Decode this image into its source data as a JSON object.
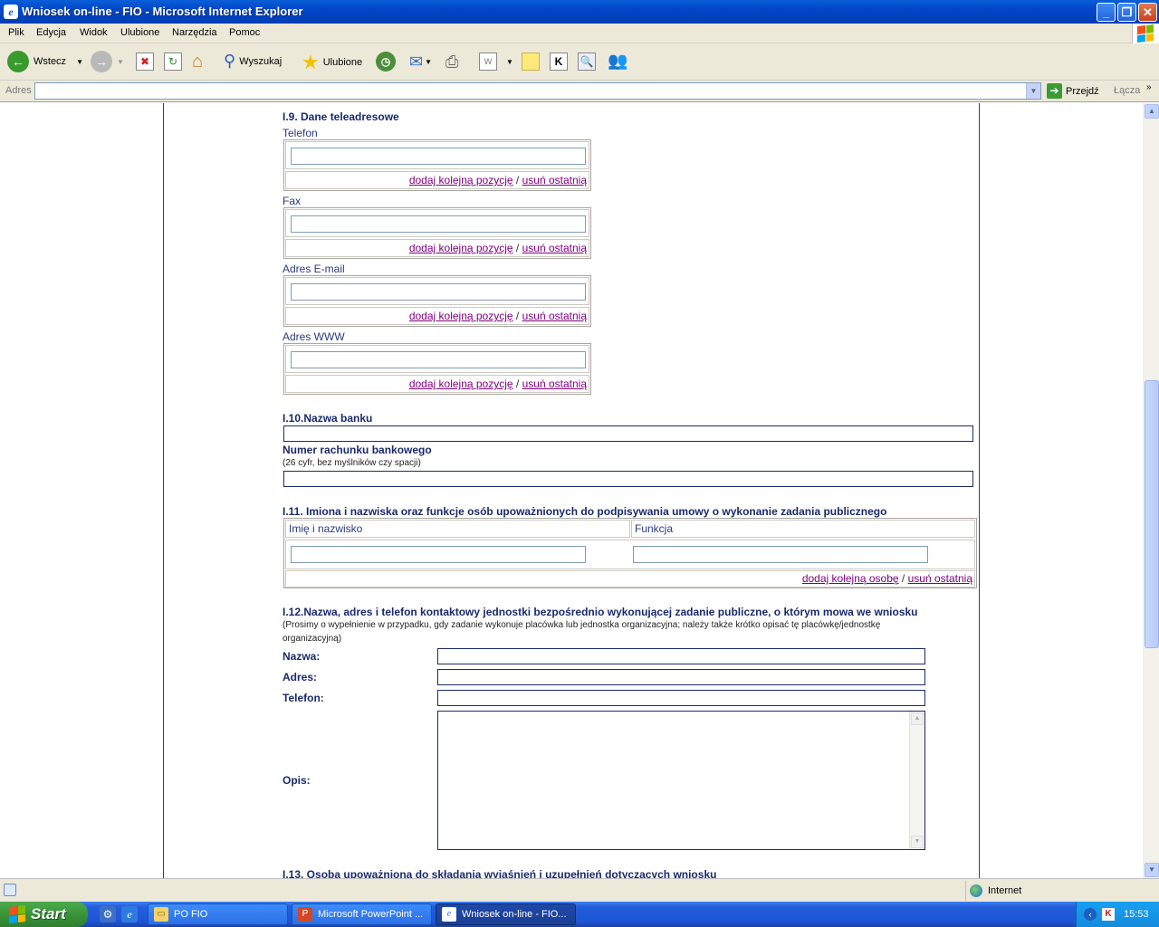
{
  "window": {
    "title": "Wniosek on-line - FIO - Microsoft Internet Explorer"
  },
  "menu": [
    "Plik",
    "Edycja",
    "Widok",
    "Ulubione",
    "Narzędzia",
    "Pomoc"
  ],
  "toolbar": {
    "back": "Wstecz",
    "search": "Wyszukaj",
    "favorites": "Ulubione"
  },
  "address": {
    "label": "Adres",
    "value": "",
    "go": "Przejdź",
    "links": "Łącza"
  },
  "form": {
    "s9_title": "I.9. Dane teleadresowe",
    "phone_label": "Telefon",
    "fax_label": "Fax",
    "email_label": "Adres E-mail",
    "www_label": "Adres WWW",
    "add_position": "dodaj kolejną pozycję",
    "remove_last": "usuń ostatnią",
    "slash": "/",
    "s10_title": "I.10.Nazwa banku",
    "account_label": "Numer rachunku bankowego",
    "account_note": "(26 cyfr, bez myślników czy spacji)",
    "s11_title": "I.11. Imiona i nazwiska oraz funkcje osób upoważnionych do podpisywania umowy o wykonanie zadania publicznego",
    "col_name": "Imię i nazwisko",
    "col_function": "Funkcja",
    "add_person": "dodaj kolejną osobę",
    "s12_title": "I.12.Nazwa, adres i telefon kontaktowy jednostki bezpośrednio wykonującej zadanie publiczne, o którym mowa we wniosku",
    "s12_note_1": "(Prosimy o wypełnienie w przypadku, gdy zadanie wykonuje placówka lub jednostka organizacyjna; należy także krótko opisać tę placówkę/jednostkę",
    "s12_note_2": "organizacyjną)",
    "name_label": "Nazwa:",
    "address_label": "Adres:",
    "phone2_label": "Telefon:",
    "desc_label": "Opis:",
    "s13_title": "I.13. Osoba upoważniona do składania wyjaśnień i uzupełnień dotyczących wniosku"
  },
  "status": {
    "zone": "Internet"
  },
  "taskbar": {
    "start": "Start",
    "tasks": [
      "PO FIO",
      "Microsoft PowerPoint ...",
      "Wniosek on-line - FIO..."
    ],
    "clock": "15:53"
  },
  "colors": {
    "accent": "#1a2a6c",
    "link": "#800080",
    "frame": "#2b3f7f"
  }
}
